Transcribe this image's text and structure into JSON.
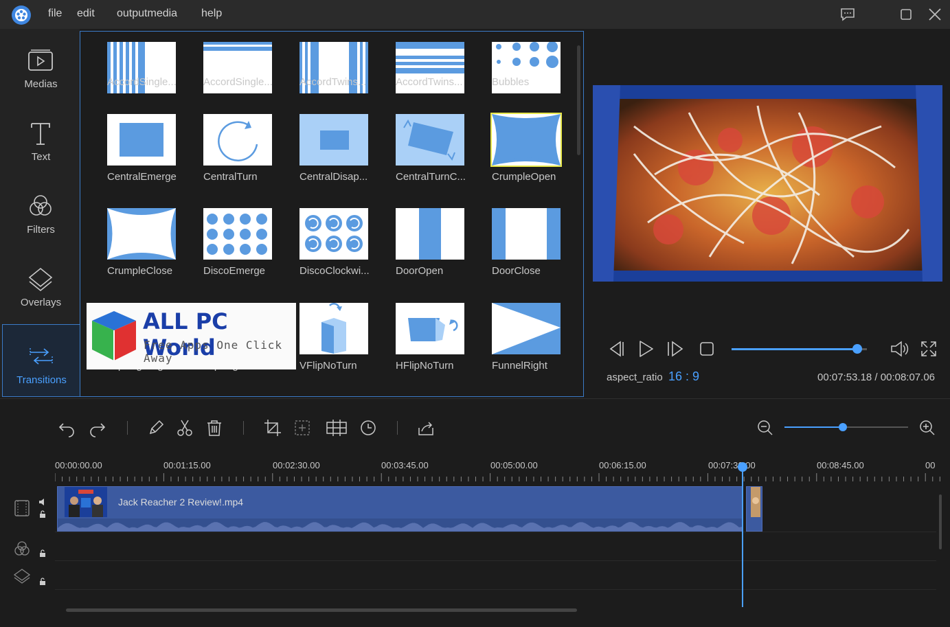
{
  "menu": {
    "file": "file",
    "edit": "edit",
    "output": "outputmedia",
    "help": "help"
  },
  "sidebar": {
    "items": [
      {
        "label": "Medias",
        "icon": "media-icon"
      },
      {
        "label": "Text",
        "icon": "text-icon"
      },
      {
        "label": "Filters",
        "icon": "filters-icon"
      },
      {
        "label": "Overlays",
        "icon": "overlays-icon"
      },
      {
        "label": "Transitions",
        "icon": "transitions-icon",
        "active": true
      }
    ]
  },
  "transitions": [
    "AccordSingle...",
    "AccordSingle...",
    "AccordTwins...",
    "AccordTwins...",
    "Bubbles",
    "CentralEmerge",
    "CentralTurn",
    "CentralDisap...",
    "CentralTurnC...",
    "CrumpleOpen",
    "CrumpleClose",
    "DiscoEmerge",
    "DiscoClockwi...",
    "DoorOpen",
    "DoorClose",
    "FlipPageRight",
    "FlipPageDown",
    "VFlipNoTurn",
    "HFlipNoTurn",
    "FunnelRight"
  ],
  "watermark": {
    "title": "ALL PC World",
    "subtitle": "Free Apps One Click Away"
  },
  "preview": {
    "aspect_label": "aspect_ratio",
    "aspect_value": "16 : 9",
    "timecode": "00:07:53.18 / 00:08:07.06",
    "progress": 0.93
  },
  "zoom": {
    "level": 0.47
  },
  "timeline": {
    "ruler": [
      "00:00:00.00",
      "00:01:15.00",
      "00:02:30.00",
      "00:03:45.00",
      "00:05:00.00",
      "00:06:15.00",
      "00:07:30.00",
      "00:08:45.00",
      "00"
    ],
    "clip_name": "Jack Reacher 2 Review!.mp4"
  },
  "colors": {
    "accent": "#4aa0ff",
    "tile_blue": "#5b9be0",
    "selection": "#e6e64a"
  }
}
